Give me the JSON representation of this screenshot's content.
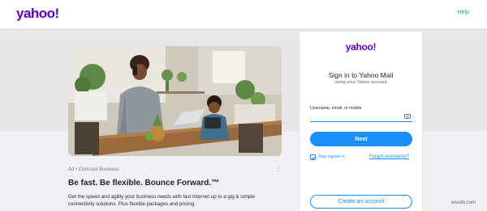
{
  "header": {
    "logo": "yahoo!",
    "help_link": "Help"
  },
  "ad": {
    "image_alt": "Woman on phone and child using a tablet at a kitchen table",
    "sponsor": "Ad • Comcast Business",
    "more_icon": "more-vertical-icon",
    "headline": "Be fast. Be flexible. Bounce Forward.™",
    "body": "Get the speed and agility your business needs with fast Internet up to a gig & simple connectivity solutions. Plus flexible packages and pricing."
  },
  "login": {
    "logo": "yahoo!",
    "title": "Sign in to Yahoo Mail",
    "subtitle": "using your Yahoo account",
    "username_label": "Username, email, or mobile",
    "username_value": "",
    "username_icon": "keyboard-icon",
    "next_label": "Next",
    "stay_signed_in_label": "Stay signed in",
    "stay_signed_in_checked": true,
    "forgot_label": "Forgot username?",
    "create_account_label": "Create an account"
  },
  "watermark": "wsxdn.com",
  "colors": {
    "brand": "#6001d2",
    "accent": "#188fff",
    "band_top": "#e7e7ea",
    "band_bottom": "#f1f1f5"
  }
}
